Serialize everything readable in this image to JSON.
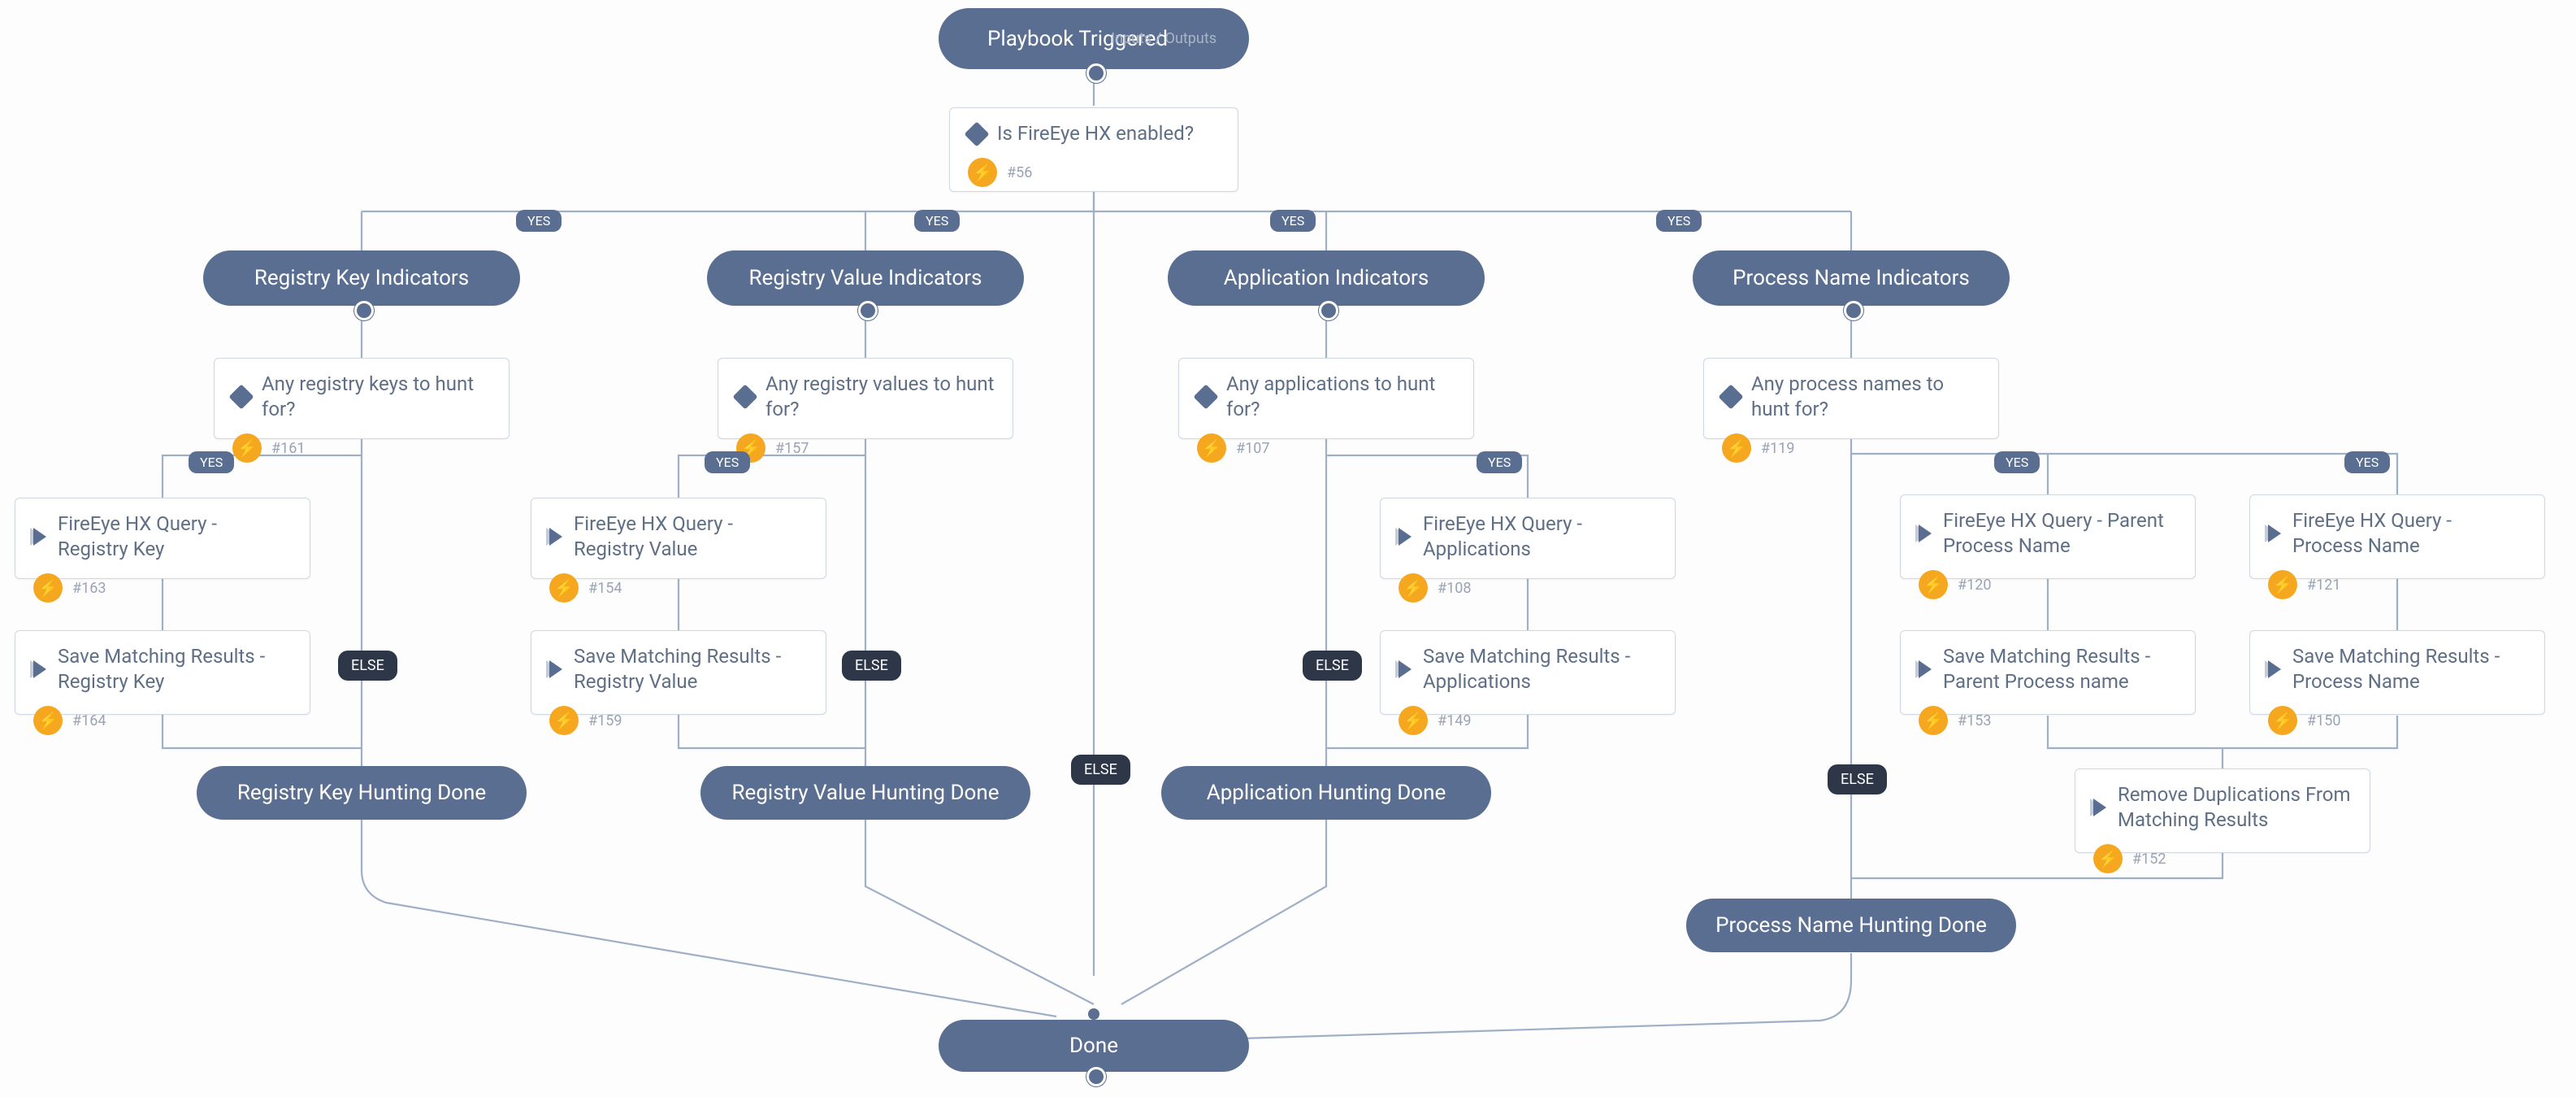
{
  "colors": {
    "nodeFill": "#5a6e91",
    "cardBorder": "#cfd7e3",
    "bolt": "#f6a720",
    "else": "#2d3748"
  },
  "trigger": {
    "title": "Playbook Triggered",
    "io_label": "Inputs / Outputs"
  },
  "root_condition": {
    "title": "Is FireEye HX enabled?",
    "id": "#56"
  },
  "labels": {
    "yes": "YES",
    "else": "ELSE"
  },
  "branches": [
    {
      "key": "regkey",
      "section": "Registry Key Indicators",
      "cond": {
        "title": "Any registry keys to hunt for?",
        "id": "#161"
      },
      "query": {
        "title": "FireEye HX Query - Registry Key",
        "id": "#163"
      },
      "save": {
        "title": "Save Matching Results - Registry Key",
        "id": "#164"
      },
      "done": "Registry Key Hunting Done"
    },
    {
      "key": "regval",
      "section": "Registry Value Indicators",
      "cond": {
        "title": "Any registry values to hunt for?",
        "id": "#157"
      },
      "query": {
        "title": "FireEye HX Query - Registry Value",
        "id": "#154"
      },
      "save": {
        "title": "Save Matching Results - Registry Value",
        "id": "#159"
      },
      "done": "Registry Value Hunting Done"
    },
    {
      "key": "app",
      "section": "Application Indicators",
      "cond": {
        "title": "Any applications to hunt for?",
        "id": "#107"
      },
      "query": {
        "title": "FireEye HX Query - Applications",
        "id": "#108"
      },
      "save": {
        "title": "Save Matching Results - Applications",
        "id": "#149"
      },
      "done": "Application Hunting Done"
    },
    {
      "key": "proc",
      "section": "Process Name Indicators",
      "cond": {
        "title": "Any process names to hunt for?",
        "id": "#119"
      },
      "queryA": {
        "title": "FireEye HX Query - Parent Process Name",
        "id": "#120"
      },
      "queryB": {
        "title": "FireEye HX Query - Process Name",
        "id": "#121"
      },
      "saveA": {
        "title": "Save Matching Results - Parent Process name",
        "id": "#153"
      },
      "saveB": {
        "title": "Save Matching Results - Process Name",
        "id": "#150"
      },
      "dedup": {
        "title": "Remove Duplications From Matching Results",
        "id": "#152"
      },
      "done": "Process Name Hunting Done"
    }
  ],
  "final": "Done"
}
